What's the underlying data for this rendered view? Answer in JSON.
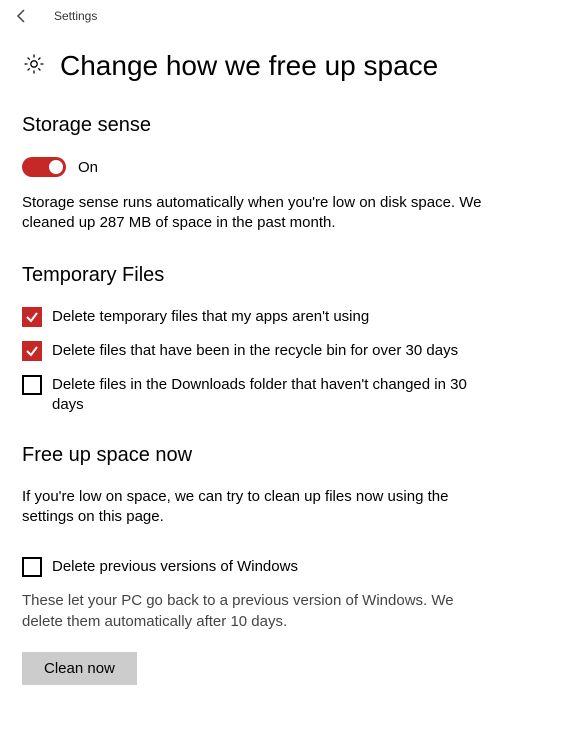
{
  "titlebar": {
    "app_name": "Settings"
  },
  "page": {
    "title": "Change how we free up space"
  },
  "storage_sense": {
    "heading": "Storage sense",
    "toggle": {
      "state": "On",
      "on": true
    },
    "description": "Storage sense runs automatically when you're low on disk space. We cleaned up 287 MB of space in the past month."
  },
  "temporary_files": {
    "heading": "Temporary Files",
    "options": [
      {
        "label": "Delete temporary files that my apps aren't using",
        "checked": true
      },
      {
        "label": "Delete files that have been in the recycle bin for over 30 days",
        "checked": true
      },
      {
        "label": "Delete files in the Downloads folder that haven't changed in 30 days",
        "checked": false
      }
    ]
  },
  "free_up": {
    "heading": "Free up space now",
    "description": "If you're low on space, we can try to clean up files now using the settings on this page.",
    "previous_versions": {
      "label": "Delete previous versions of Windows",
      "checked": false,
      "help": "These let your PC go back to a previous version of Windows. We delete them automatically after 10 days."
    },
    "button": "Clean now"
  }
}
